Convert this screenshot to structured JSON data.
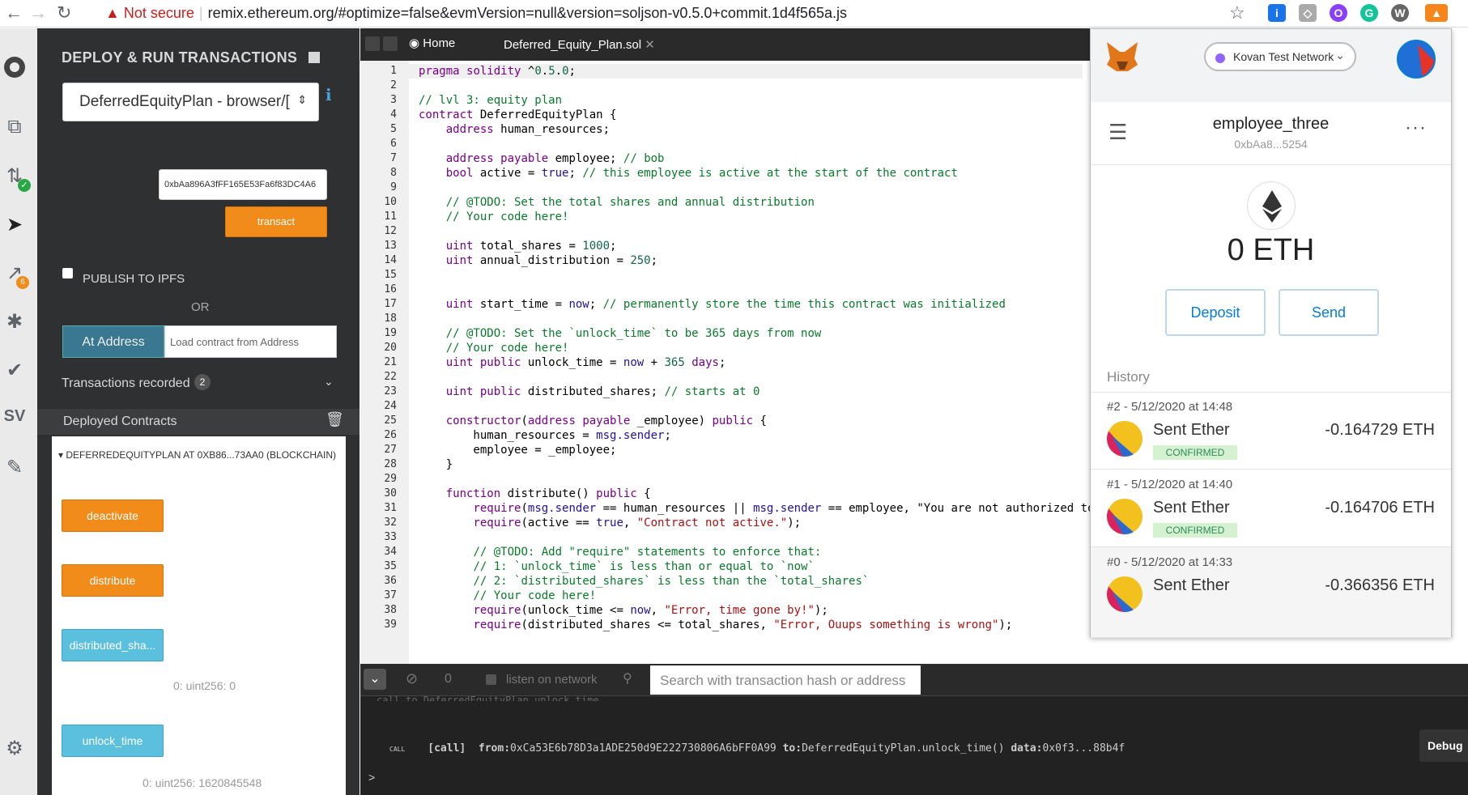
{
  "browser": {
    "security_label": "Not secure",
    "url": "remix.ethereum.org/#optimize=false&evmVersion=null&version=soljson-v0.5.0+commit.1d4f565a.js"
  },
  "deploy": {
    "title": "DEPLOY & RUN TRANSACTIONS",
    "contract_select": "DeferredEquityPlan - browser/[",
    "address_input": "0xbAa896A3fFF165E53Fa6f83DC4A6",
    "transact_label": "transact",
    "publish_label": "PUBLISH TO IPFS",
    "or_label": "OR",
    "at_address_label": "At Address",
    "load_placeholder": "Load contract from Address",
    "tx_recorded_label": "Transactions recorded",
    "tx_recorded_count": "2",
    "deployed_label": "Deployed Contracts",
    "instance_label": "DEFERREDEQUITYPLAN AT 0XB86...73AA0 (BLOCKCHAIN)",
    "buttons": {
      "deactivate": "deactivate",
      "distribute": "distribute",
      "distributed_shares": "distributed_sha...",
      "distributed_shares_result": "0: uint256: 0",
      "unlock_time": "unlock_time",
      "unlock_time_result": "0: uint256: 1620845548"
    }
  },
  "editor": {
    "home_tab": "Home",
    "file_tab": "Deferred_Equity_Plan.sol",
    "lines": [
      "pragma solidity ^0.5.0;",
      "",
      "// lvl 3: equity plan",
      "contract DeferredEquityPlan {",
      "    address human_resources;",
      "",
      "    address payable employee; // bob",
      "    bool active = true; // this employee is active at the start of the contract",
      "",
      "    // @TODO: Set the total shares and annual distribution",
      "    // Your code here!",
      "",
      "    uint total_shares = 1000;",
      "    uint annual_distribution = 250;",
      "",
      "",
      "    uint start_time = now; // permanently store the time this contract was initialized",
      "",
      "    // @TODO: Set the `unlock_time` to be 365 days from now",
      "    // Your code here!",
      "    uint public unlock_time = now + 365 days;",
      "",
      "    uint public distributed_shares; // starts at 0",
      "",
      "    constructor(address payable _employee) public {",
      "        human_resources = msg.sender;",
      "        employee = _employee;",
      "    }",
      "",
      "    function distribute() public {",
      "        require(msg.sender == human_resources || msg.sender == employee, \"You are not authorized to ex",
      "        require(active == true, \"Contract not active.\");",
      "",
      "        // @TODO: Add \"require\" statements to enforce that:",
      "        // 1: `unlock_time` is less than or equal to `now`",
      "        // 2: `distributed_shares` is less than the `total_shares`",
      "        // Your code here!",
      "        require(unlock_time <= now, \"Error, time gone by!\");",
      "        require(distributed_shares <= total_shares, \"Error, Ouups something is wrong\");"
    ]
  },
  "terminal": {
    "count": "0",
    "listen_label": "listen on network",
    "search_placeholder": "Search with transaction hash or address",
    "faded_line": "call to DeferredEquityPlan.unlock_time",
    "call_tag": "CALL",
    "call_text": "[call]",
    "from_label": "from:",
    "from_value": "0xCa53E6b78D3a1ADE250d9E222730806A6bFF0A99",
    "to_label": "to:",
    "to_value": "DeferredEquityPlan.unlock_time()",
    "data_label": "data:",
    "data_value": "0x0f3...88b4f",
    "debug_label": "Debug",
    "prompt": ">"
  },
  "metamask": {
    "network": "Kovan Test Network",
    "account_name": "employee_three",
    "account_addr": "0xbAa8...5254",
    "balance": "0 ETH",
    "deposit_label": "Deposit",
    "send_label": "Send",
    "history_label": "History",
    "history": [
      {
        "date": "#2 - 5/12/2020 at 14:48",
        "title": "Sent Ether",
        "amount": "-0.164729 ETH",
        "status": "CONFIRMED"
      },
      {
        "date": "#1 - 5/12/2020 at 14:40",
        "title": "Sent Ether",
        "amount": "-0.164706 ETH",
        "status": "CONFIRMED"
      },
      {
        "date": "#0 - 5/12/2020 at 14:33",
        "title": "Sent Ether",
        "amount": "-0.366356 ETH",
        "status": ""
      }
    ]
  }
}
